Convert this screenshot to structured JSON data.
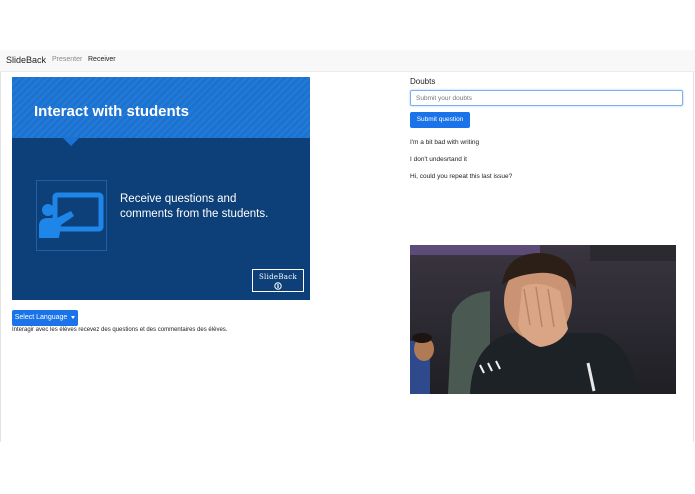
{
  "navbar": {
    "brand": "SlideBack",
    "links": [
      {
        "label": "Presenter",
        "active": false
      },
      {
        "label": "Receiver",
        "active": true
      }
    ]
  },
  "slide": {
    "title": "Interact with students",
    "body": "Receive questions and comments from the students.",
    "logo_text": "SlideBack",
    "icon": "presentation-board-icon",
    "colors": {
      "header": "#1a73d2",
      "background": "#0d3f78"
    }
  },
  "language": {
    "button_label": "Select Language",
    "translation": "Interagir avec les élèves recevez des questions et des commentaires des élèves."
  },
  "doubts": {
    "heading": "Doubts",
    "input_value": "",
    "input_placeholder": "Submit your doubts",
    "submit_label": "Submit question",
    "questions": [
      "I'm a bit bad with writing",
      "I don't undesrtand it",
      "Hi, could you repeat this last issue?"
    ]
  },
  "webcam": {
    "content": "live-camera-feed"
  },
  "theme": {
    "accent": "#1a73e8"
  }
}
